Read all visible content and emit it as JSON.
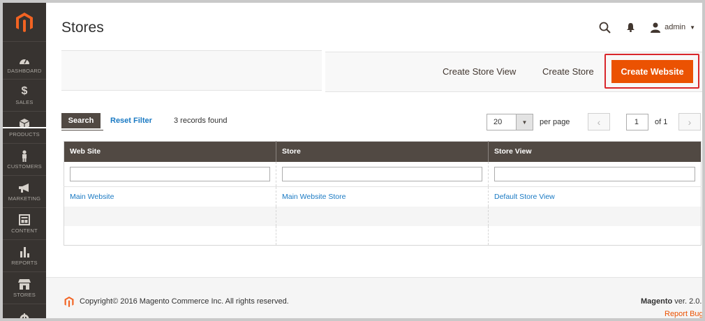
{
  "sidebar": {
    "logo": "magento-logo-icon",
    "items": [
      {
        "label": "DASHBOARD",
        "icon": "speedometer-icon"
      },
      {
        "label": "SALES",
        "icon": "dollar-icon"
      },
      {
        "label": "PRODUCTS",
        "icon": "cube-icon"
      },
      {
        "label": "CUSTOMERS",
        "icon": "person-icon"
      },
      {
        "label": "MARKETING",
        "icon": "megaphone-icon"
      },
      {
        "label": "CONTENT",
        "icon": "layout-icon"
      },
      {
        "label": "REPORTS",
        "icon": "bar-chart-icon"
      },
      {
        "label": "STORES",
        "icon": "storefront-icon"
      }
    ]
  },
  "header": {
    "title": "Stores",
    "user": "admin"
  },
  "actions": {
    "create_store_view": "Create Store View",
    "create_store": "Create Store",
    "create_website": "Create Website"
  },
  "grid_controls": {
    "search": "Search",
    "reset_filter": "Reset Filter",
    "records_found": "3 records found",
    "per_page_value": "20",
    "per_page_label": "per page",
    "page_value": "1",
    "page_of": "of 1"
  },
  "table": {
    "columns": [
      "Web Site",
      "Store",
      "Store View"
    ],
    "rows": [
      [
        "Main Website",
        "Main Website Store",
        "Default Store View"
      ],
      [
        "",
        "",
        ""
      ],
      [
        "",
        "",
        ""
      ]
    ]
  },
  "footer": {
    "copyright": "Copyright© 2016 Magento Commerce Inc. All rights reserved.",
    "brand": "Magento",
    "version": "ver. 2.0.",
    "report_bugs": "Report Bug"
  },
  "colors": {
    "sidebar_bg": "#373330",
    "accent": "#eb5202",
    "header_bg": "#514943",
    "link": "#1979c3",
    "highlight": "#d9262b"
  }
}
